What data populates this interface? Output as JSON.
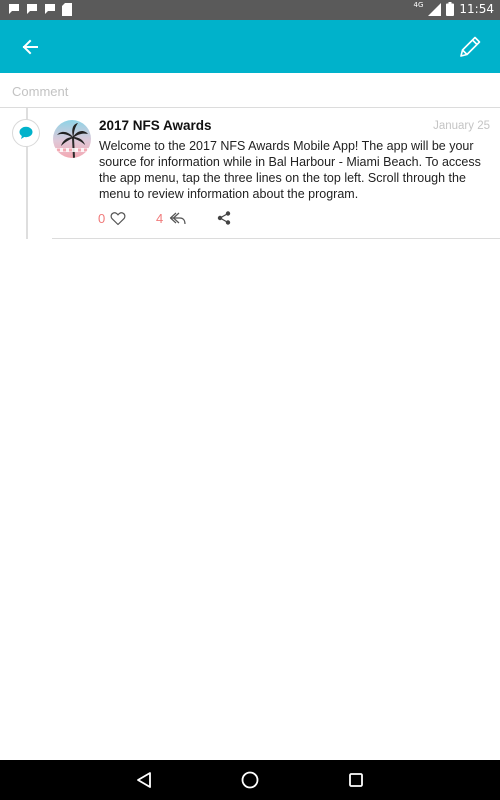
{
  "status_bar": {
    "time": "11:54",
    "network": "4G",
    "icons": [
      "chat-notification-icon",
      "chat-notification-icon",
      "chat-notification-icon",
      "sd-card-icon",
      "signal-icon",
      "battery-icon"
    ]
  },
  "app_bar": {
    "back_icon": "arrow-left-icon",
    "edit_icon": "pencil-icon",
    "color": "#00b2cb"
  },
  "comment": {
    "placeholder": "Comment"
  },
  "post": {
    "title": "2017 NFS Awards",
    "date": "January 25",
    "body": "Welcome to the 2017 NFS Awards Mobile App! The app will be your source for information while in Bal Harbour - Miami Beach. To access the app menu, tap the three lines on the top left. Scroll through the menu to review information about the program.",
    "likes": "0",
    "replies": "4",
    "accent_color": "#f07a7a",
    "type_icon": "chat-bubble-icon"
  },
  "nav_bar": {
    "icons": [
      "back-triangle-icon",
      "home-circle-icon",
      "recents-square-icon"
    ]
  }
}
